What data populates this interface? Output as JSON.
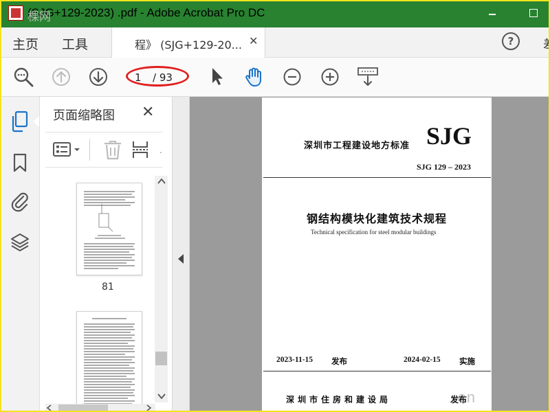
{
  "window": {
    "title": "(SJG+129-2023)  .pdf - Adobe Acrobat Pro DC",
    "watermark_logo": "棵网",
    "watermark_corner": ".cn"
  },
  "menu": {
    "home": "主页",
    "tools": "工具",
    "doc_tab_label": "程》 (SJG+129-20...",
    "partial_tab": "差"
  },
  "toolbar": {
    "current_page": "1",
    "total_pages": "/ 93"
  },
  "thumb_panel": {
    "title": "页面缩略图",
    "page_label_81": "81"
  },
  "doc": {
    "std_org": "深圳市工程建设地方标准",
    "std_code": "SJG",
    "std_number": "SJG 129 – 2023",
    "title_cn": "钢结构模块化建筑技术规程",
    "title_en": "Technical specification for steel modular buildings",
    "issue_date": "2023-11-15",
    "issue_label": "发布",
    "impl_date": "2024-02-15",
    "impl_label": "实施",
    "publisher": "深 圳 市 住 房 和 建 设 局",
    "publisher_action": "发布"
  },
  "colors": {
    "titlebar": "#288230",
    "icon_blue": "#1a73c8",
    "highlight_ring": "#e02020",
    "frame": "#f4e41c"
  }
}
